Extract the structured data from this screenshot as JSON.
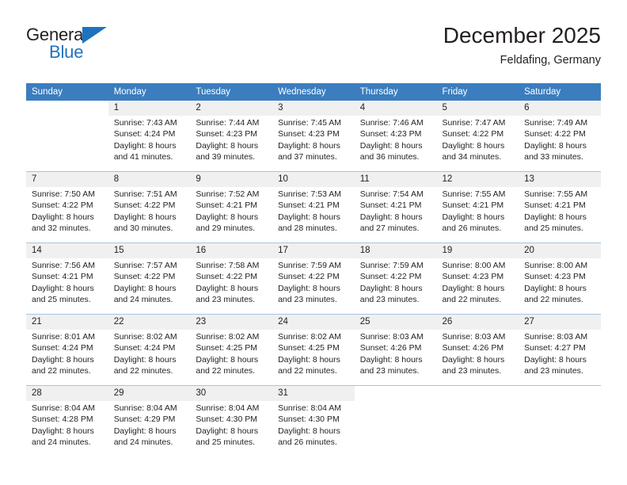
{
  "brand": {
    "name_part1": "General",
    "name_part2": "Blue",
    "accent_color": "#1e73be"
  },
  "header": {
    "title": "December 2025",
    "subtitle": "Feldafing, Germany"
  },
  "theme": {
    "header_bg": "#3b7dbf",
    "daynum_bg": "#f0f0f0",
    "text": "#231f20"
  },
  "weekday_headers": [
    "Sunday",
    "Monday",
    "Tuesday",
    "Wednesday",
    "Thursday",
    "Friday",
    "Saturday"
  ],
  "weeks": [
    {
      "days": [
        {
          "num": "",
          "sunrise": "",
          "sunset": "",
          "daylight1": "",
          "daylight2": ""
        },
        {
          "num": "1",
          "sunrise": "Sunrise: 7:43 AM",
          "sunset": "Sunset: 4:24 PM",
          "daylight1": "Daylight: 8 hours",
          "daylight2": "and 41 minutes."
        },
        {
          "num": "2",
          "sunrise": "Sunrise: 7:44 AM",
          "sunset": "Sunset: 4:23 PM",
          "daylight1": "Daylight: 8 hours",
          "daylight2": "and 39 minutes."
        },
        {
          "num": "3",
          "sunrise": "Sunrise: 7:45 AM",
          "sunset": "Sunset: 4:23 PM",
          "daylight1": "Daylight: 8 hours",
          "daylight2": "and 37 minutes."
        },
        {
          "num": "4",
          "sunrise": "Sunrise: 7:46 AM",
          "sunset": "Sunset: 4:23 PM",
          "daylight1": "Daylight: 8 hours",
          "daylight2": "and 36 minutes."
        },
        {
          "num": "5",
          "sunrise": "Sunrise: 7:47 AM",
          "sunset": "Sunset: 4:22 PM",
          "daylight1": "Daylight: 8 hours",
          "daylight2": "and 34 minutes."
        },
        {
          "num": "6",
          "sunrise": "Sunrise: 7:49 AM",
          "sunset": "Sunset: 4:22 PM",
          "daylight1": "Daylight: 8 hours",
          "daylight2": "and 33 minutes."
        }
      ]
    },
    {
      "days": [
        {
          "num": "7",
          "sunrise": "Sunrise: 7:50 AM",
          "sunset": "Sunset: 4:22 PM",
          "daylight1": "Daylight: 8 hours",
          "daylight2": "and 32 minutes."
        },
        {
          "num": "8",
          "sunrise": "Sunrise: 7:51 AM",
          "sunset": "Sunset: 4:22 PM",
          "daylight1": "Daylight: 8 hours",
          "daylight2": "and 30 minutes."
        },
        {
          "num": "9",
          "sunrise": "Sunrise: 7:52 AM",
          "sunset": "Sunset: 4:21 PM",
          "daylight1": "Daylight: 8 hours",
          "daylight2": "and 29 minutes."
        },
        {
          "num": "10",
          "sunrise": "Sunrise: 7:53 AM",
          "sunset": "Sunset: 4:21 PM",
          "daylight1": "Daylight: 8 hours",
          "daylight2": "and 28 minutes."
        },
        {
          "num": "11",
          "sunrise": "Sunrise: 7:54 AM",
          "sunset": "Sunset: 4:21 PM",
          "daylight1": "Daylight: 8 hours",
          "daylight2": "and 27 minutes."
        },
        {
          "num": "12",
          "sunrise": "Sunrise: 7:55 AM",
          "sunset": "Sunset: 4:21 PM",
          "daylight1": "Daylight: 8 hours",
          "daylight2": "and 26 minutes."
        },
        {
          "num": "13",
          "sunrise": "Sunrise: 7:55 AM",
          "sunset": "Sunset: 4:21 PM",
          "daylight1": "Daylight: 8 hours",
          "daylight2": "and 25 minutes."
        }
      ]
    },
    {
      "days": [
        {
          "num": "14",
          "sunrise": "Sunrise: 7:56 AM",
          "sunset": "Sunset: 4:21 PM",
          "daylight1": "Daylight: 8 hours",
          "daylight2": "and 25 minutes."
        },
        {
          "num": "15",
          "sunrise": "Sunrise: 7:57 AM",
          "sunset": "Sunset: 4:22 PM",
          "daylight1": "Daylight: 8 hours",
          "daylight2": "and 24 minutes."
        },
        {
          "num": "16",
          "sunrise": "Sunrise: 7:58 AM",
          "sunset": "Sunset: 4:22 PM",
          "daylight1": "Daylight: 8 hours",
          "daylight2": "and 23 minutes."
        },
        {
          "num": "17",
          "sunrise": "Sunrise: 7:59 AM",
          "sunset": "Sunset: 4:22 PM",
          "daylight1": "Daylight: 8 hours",
          "daylight2": "and 23 minutes."
        },
        {
          "num": "18",
          "sunrise": "Sunrise: 7:59 AM",
          "sunset": "Sunset: 4:22 PM",
          "daylight1": "Daylight: 8 hours",
          "daylight2": "and 23 minutes."
        },
        {
          "num": "19",
          "sunrise": "Sunrise: 8:00 AM",
          "sunset": "Sunset: 4:23 PM",
          "daylight1": "Daylight: 8 hours",
          "daylight2": "and 22 minutes."
        },
        {
          "num": "20",
          "sunrise": "Sunrise: 8:00 AM",
          "sunset": "Sunset: 4:23 PM",
          "daylight1": "Daylight: 8 hours",
          "daylight2": "and 22 minutes."
        }
      ]
    },
    {
      "days": [
        {
          "num": "21",
          "sunrise": "Sunrise: 8:01 AM",
          "sunset": "Sunset: 4:24 PM",
          "daylight1": "Daylight: 8 hours",
          "daylight2": "and 22 minutes."
        },
        {
          "num": "22",
          "sunrise": "Sunrise: 8:02 AM",
          "sunset": "Sunset: 4:24 PM",
          "daylight1": "Daylight: 8 hours",
          "daylight2": "and 22 minutes."
        },
        {
          "num": "23",
          "sunrise": "Sunrise: 8:02 AM",
          "sunset": "Sunset: 4:25 PM",
          "daylight1": "Daylight: 8 hours",
          "daylight2": "and 22 minutes."
        },
        {
          "num": "24",
          "sunrise": "Sunrise: 8:02 AM",
          "sunset": "Sunset: 4:25 PM",
          "daylight1": "Daylight: 8 hours",
          "daylight2": "and 22 minutes."
        },
        {
          "num": "25",
          "sunrise": "Sunrise: 8:03 AM",
          "sunset": "Sunset: 4:26 PM",
          "daylight1": "Daylight: 8 hours",
          "daylight2": "and 23 minutes."
        },
        {
          "num": "26",
          "sunrise": "Sunrise: 8:03 AM",
          "sunset": "Sunset: 4:26 PM",
          "daylight1": "Daylight: 8 hours",
          "daylight2": "and 23 minutes."
        },
        {
          "num": "27",
          "sunrise": "Sunrise: 8:03 AM",
          "sunset": "Sunset: 4:27 PM",
          "daylight1": "Daylight: 8 hours",
          "daylight2": "and 23 minutes."
        }
      ]
    },
    {
      "days": [
        {
          "num": "28",
          "sunrise": "Sunrise: 8:04 AM",
          "sunset": "Sunset: 4:28 PM",
          "daylight1": "Daylight: 8 hours",
          "daylight2": "and 24 minutes."
        },
        {
          "num": "29",
          "sunrise": "Sunrise: 8:04 AM",
          "sunset": "Sunset: 4:29 PM",
          "daylight1": "Daylight: 8 hours",
          "daylight2": "and 24 minutes."
        },
        {
          "num": "30",
          "sunrise": "Sunrise: 8:04 AM",
          "sunset": "Sunset: 4:30 PM",
          "daylight1": "Daylight: 8 hours",
          "daylight2": "and 25 minutes."
        },
        {
          "num": "31",
          "sunrise": "Sunrise: 8:04 AM",
          "sunset": "Sunset: 4:30 PM",
          "daylight1": "Daylight: 8 hours",
          "daylight2": "and 26 minutes."
        },
        {
          "num": "",
          "sunrise": "",
          "sunset": "",
          "daylight1": "",
          "daylight2": ""
        },
        {
          "num": "",
          "sunrise": "",
          "sunset": "",
          "daylight1": "",
          "daylight2": ""
        },
        {
          "num": "",
          "sunrise": "",
          "sunset": "",
          "daylight1": "",
          "daylight2": ""
        }
      ]
    }
  ]
}
